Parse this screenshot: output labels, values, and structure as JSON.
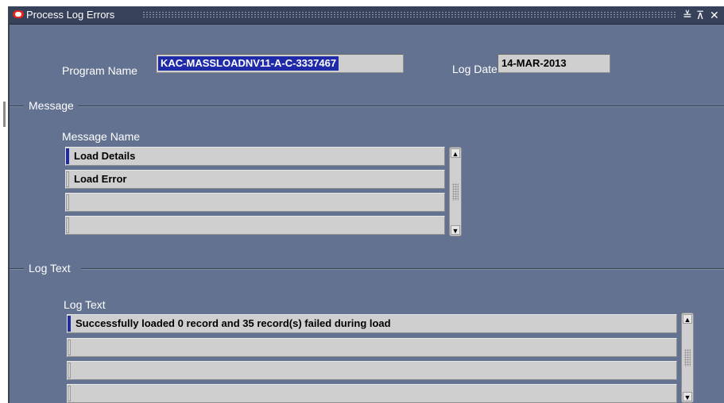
{
  "window": {
    "title": "Process Log Errors",
    "controls": {
      "minimize": "≚",
      "maximize": "⊼",
      "close": "✕"
    }
  },
  "header": {
    "program_name_label": "Program Name",
    "program_name_value": "KAC-MASSLOADNV11-A-C-3337467",
    "log_date_label": "Log Date",
    "log_date_value": "14-MAR-2013"
  },
  "message_section": {
    "title": "Message",
    "column_header": "Message Name",
    "rows": [
      "Load Details",
      "Load Error",
      "",
      ""
    ]
  },
  "log_section": {
    "title": "Log Text",
    "column_header": "Log Text",
    "rows": [
      "Successfully loaded 0 record and 35 record(s) failed during load",
      "",
      "",
      ""
    ]
  },
  "colors": {
    "background": "#627290",
    "titlebar": "#38415a",
    "field": "#cecfce",
    "selection": "#1f2aa9"
  }
}
